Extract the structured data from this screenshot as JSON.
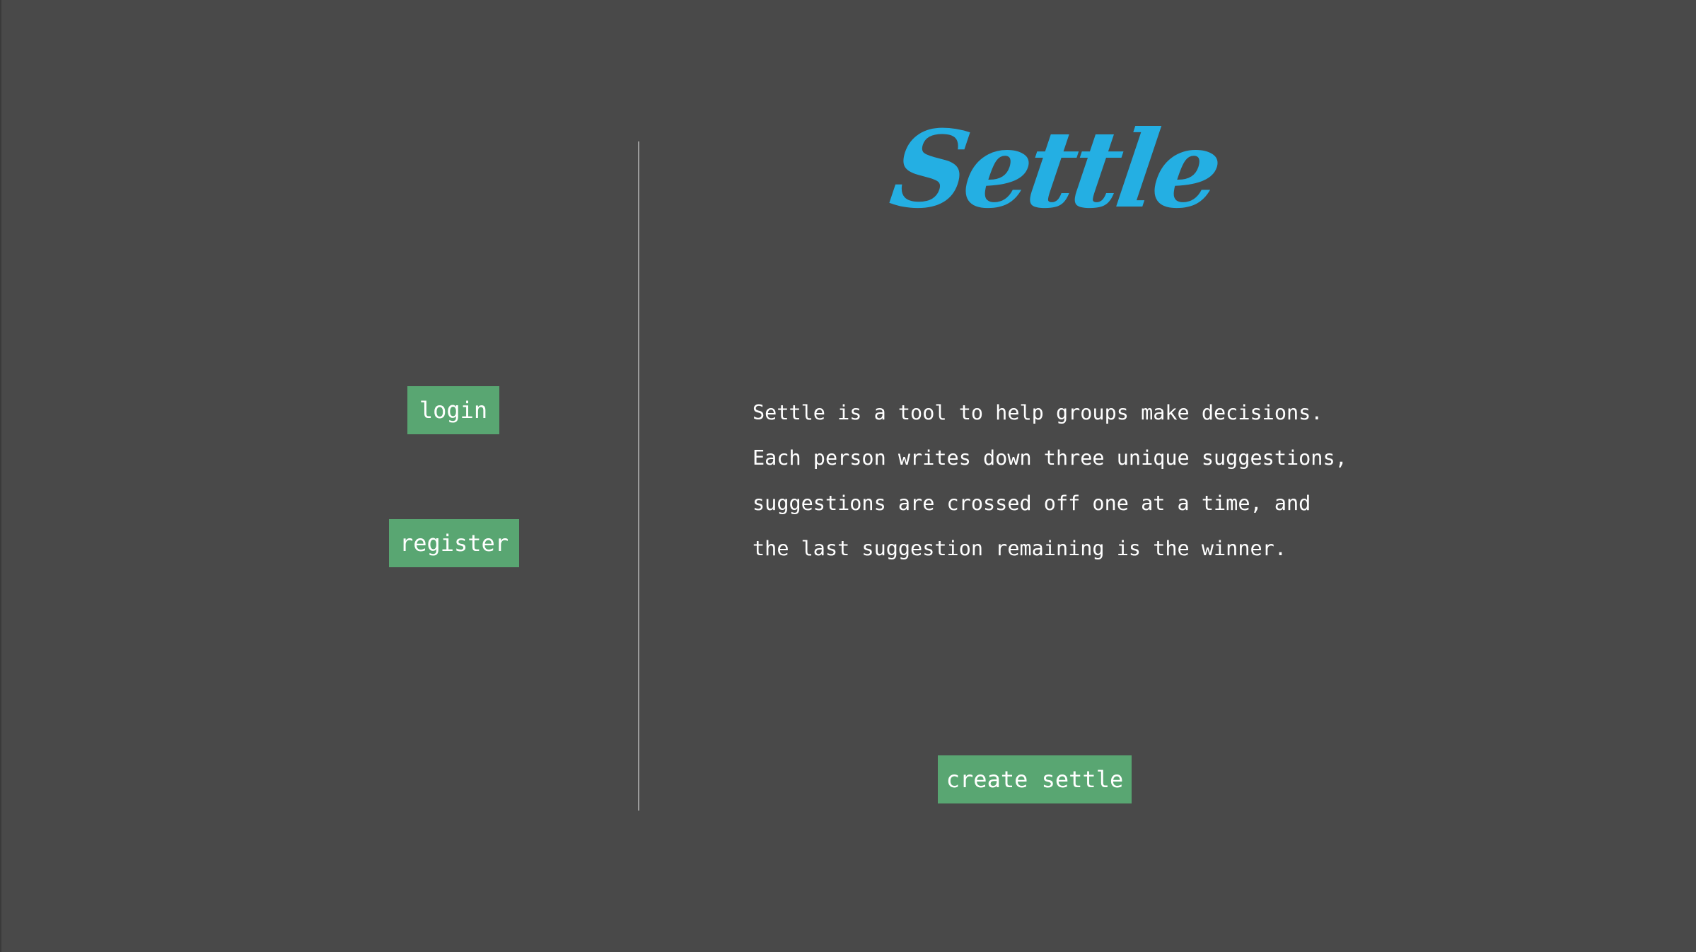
{
  "brand": {
    "logo_text": "Settle",
    "logo_color": "#24afe3"
  },
  "auth": {
    "login_label": "login",
    "register_label": "register"
  },
  "description": {
    "lines": [
      "Settle is a tool to help groups make decisions.",
      "Each person writes down three unique suggestions,",
      "suggestions are crossed off one at a time, and",
      "the last suggestion remaining is the winner."
    ]
  },
  "actions": {
    "create_label": "create settle"
  },
  "colors": {
    "background": "#494949",
    "button": "#59a672",
    "divider": "#9a9a9a",
    "text": "#ffffff"
  }
}
